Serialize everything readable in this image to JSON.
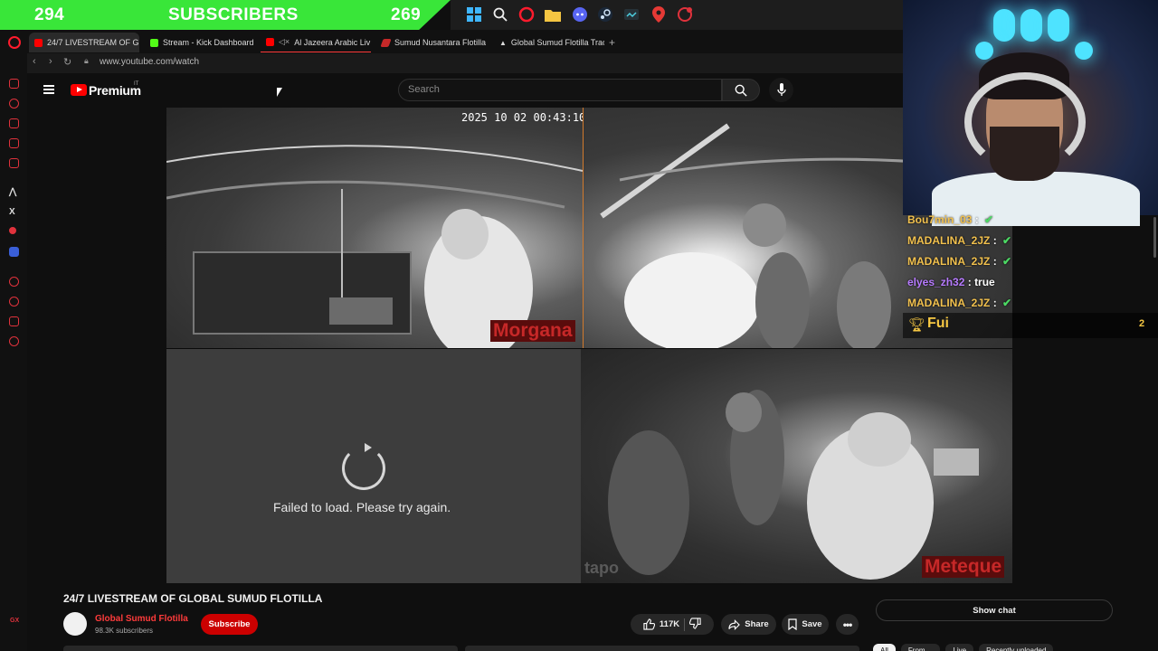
{
  "overlay": {
    "subs_left": "294",
    "subs_label": "SUBSCRIBERS",
    "subs_right": "269"
  },
  "taskbar": {
    "icons": [
      "windows-icon",
      "search-icon",
      "opera-icon",
      "folder-icon",
      "discord-icon",
      "steam-icon",
      "app-icon",
      "maps-pin-icon",
      "opera-gx-icon"
    ]
  },
  "browser": {
    "tabs": [
      {
        "label": "24/7 LIVESTREAM OF GL",
        "icon": "youtube-icon",
        "color": "#ff0000"
      },
      {
        "label": "Stream - Kick Dashboard",
        "icon": "kick-icon",
        "color": "#53fc18"
      },
      {
        "label": "Al Jazeera Arabic Liv",
        "icon": "youtube-icon",
        "color": "#ff0000"
      },
      {
        "label": "Sumud Nusantara Flotilla",
        "icon": "flotilla-icon",
        "color": "#c62828"
      },
      {
        "label": "Global Sumud Flotilla Trac",
        "icon": "tracker-icon",
        "color": "#dddddd"
      }
    ],
    "url": "www.youtube.com/watch",
    "sidebar_gx_label": "GX"
  },
  "youtube": {
    "brand": "Premium",
    "region": "IT",
    "search_placeholder": "Search"
  },
  "video": {
    "timestamp": "2025 10 02 00:43:10",
    "cam1_label": "Morgana",
    "cam4_label": "Meteque",
    "watermark": "tapo",
    "error_message": "Failed to load. Please try again."
  },
  "chat": {
    "messages": [
      {
        "user": "Bou7min_03",
        "text": ":",
        "emote": "✔",
        "user_color": "#f2c14e"
      },
      {
        "user": "MADALINA_2JZ",
        "text": ":",
        "emote": "✔",
        "user_color": "#f2c14e"
      },
      {
        "user": "MADALINA_2JZ",
        "text": ":",
        "emote": "✔",
        "user_color": "#f2c14e"
      },
      {
        "user": "elyes_zh32",
        "text": ": true",
        "emote": "",
        "user_color": "#b77bff"
      },
      {
        "user": "MADALINA_2JZ",
        "text": ":",
        "emote": "✔",
        "user_color": "#f2c14e"
      }
    ],
    "top_name": "Fui",
    "top_count": "2"
  },
  "video_info": {
    "title": "24/7 LIVESTREAM OF GLOBAL SUMUD FLOTILLA",
    "channel": "Global Sumud Flotilla",
    "subscribers": "98.3K subscribers",
    "subscribe_label": "Subscribe",
    "likes": "117K",
    "share_label": "Share",
    "save_label": "Save",
    "show_chat_label": "Show chat",
    "chips": [
      "All",
      "From ...",
      "Live",
      "Recently uploaded"
    ]
  }
}
